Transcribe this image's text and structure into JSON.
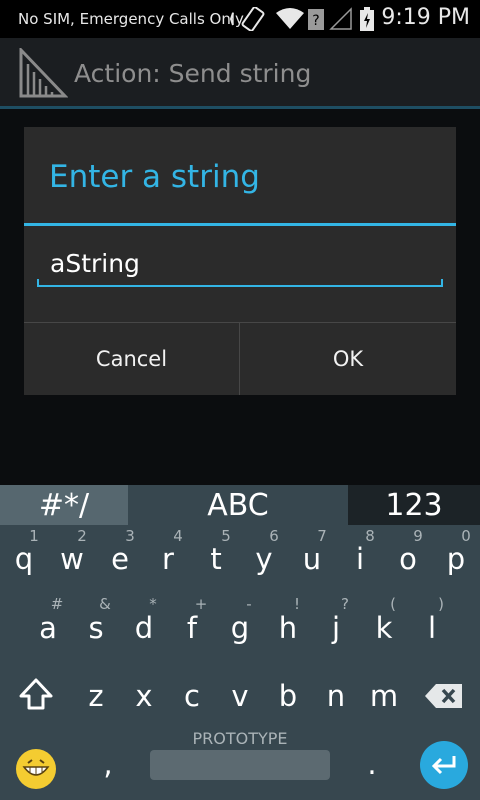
{
  "status_bar": {
    "carrier": "No SIM, Emergency Calls Only",
    "time": "9:19 PM",
    "icons": [
      "vibrate-icon",
      "wifi-icon",
      "unknown-icon",
      "signal-icon",
      "battery-charging-icon"
    ]
  },
  "action_bar": {
    "title": "Action: Send string",
    "icon": "app-ruler-icon"
  },
  "dialog": {
    "title": "Enter a string",
    "input_value": "aString",
    "cancel_label": "Cancel",
    "ok_label": "OK"
  },
  "keyboard": {
    "tabs": {
      "symbols": "#*/",
      "letters": "ABC",
      "numbers": "123"
    },
    "row1": {
      "keys": [
        "q",
        "w",
        "e",
        "r",
        "t",
        "y",
        "u",
        "i",
        "o",
        "p"
      ],
      "hints": [
        "1",
        "2",
        "3",
        "4",
        "5",
        "6",
        "7",
        "8",
        "9",
        "0"
      ]
    },
    "row2": {
      "keys": [
        "a",
        "s",
        "d",
        "f",
        "g",
        "h",
        "j",
        "k",
        "l"
      ],
      "hints": [
        "#",
        "&",
        "*",
        "+",
        "-",
        "!",
        "?",
        "(",
        ")"
      ]
    },
    "row3": {
      "keys": [
        "z",
        "x",
        "c",
        "v",
        "b",
        "n",
        "m"
      ]
    },
    "bottom": {
      "label": "PROTOTYPE",
      "comma": ",",
      "period": "."
    },
    "icons": [
      "shift-icon",
      "backspace-icon",
      "emoji-icon",
      "enter-icon"
    ]
  },
  "colors": {
    "accent": "#33b5e5",
    "keyboard_bg": "#37474f",
    "enter_button": "#29a9de"
  }
}
